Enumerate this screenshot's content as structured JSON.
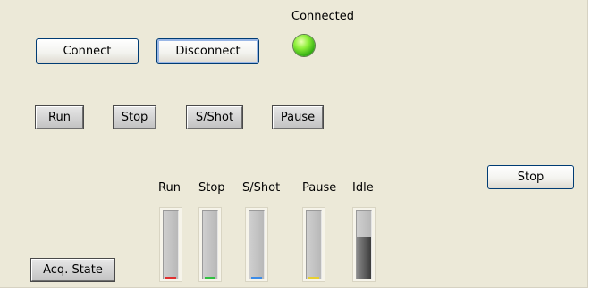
{
  "status": {
    "label": "Connected"
  },
  "connection": {
    "connect_label": "Connect",
    "disconnect_label": "Disconnect"
  },
  "controls": {
    "run_label": "Run",
    "stop_label": "Stop",
    "sshot_label": "S/Shot",
    "pause_label": "Pause"
  },
  "main_stop_label": "Stop",
  "acq_state_label": "Acq. State",
  "indicators": [
    {
      "label": "Run",
      "level": 0,
      "color": "#e03030"
    },
    {
      "label": "Stop",
      "level": 0,
      "color": "#30c040"
    },
    {
      "label": "S/Shot",
      "level": 0,
      "color": "#3c8ce8"
    },
    {
      "label": "Pause",
      "level": 0,
      "color": "#e8d030"
    },
    {
      "label": "Idle",
      "level": 0.6,
      "color": "#303030"
    }
  ],
  "colors": {
    "led_on": "#5fd62a",
    "panel_bg": "#ece9d8"
  }
}
